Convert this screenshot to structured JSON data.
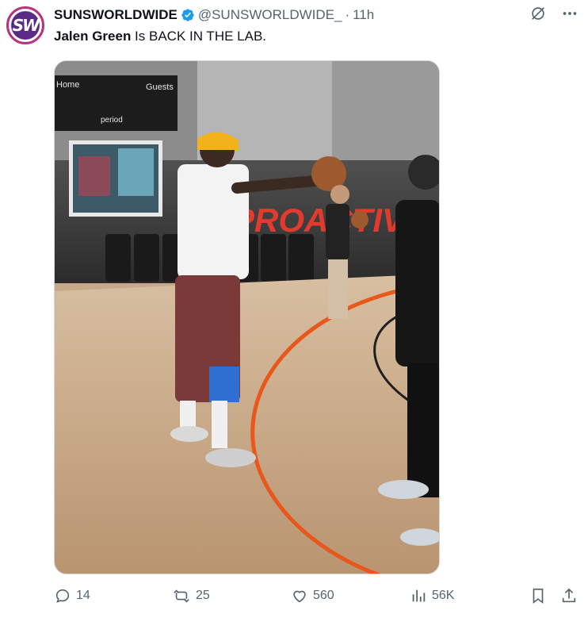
{
  "author": {
    "display_name": "SUNSWORLDWIDE",
    "handle": "@SUNSWORLDWIDE_",
    "separator": "·",
    "time": "11h",
    "avatar_text": "SW"
  },
  "tweet": {
    "mention": "Jalen Green",
    "text": " Is BACK IN THE LAB."
  },
  "media": {
    "wall_text": "PROACTIVE",
    "scoreboard_home": "Home",
    "scoreboard_guests": "Guests",
    "scoreboard_period": "period"
  },
  "metrics": {
    "replies": "14",
    "reposts": "25",
    "likes": "560",
    "views": "56K"
  },
  "colors": {
    "accent": "#1d9bf0",
    "muted": "#536471",
    "court_line": "#e8571c"
  }
}
